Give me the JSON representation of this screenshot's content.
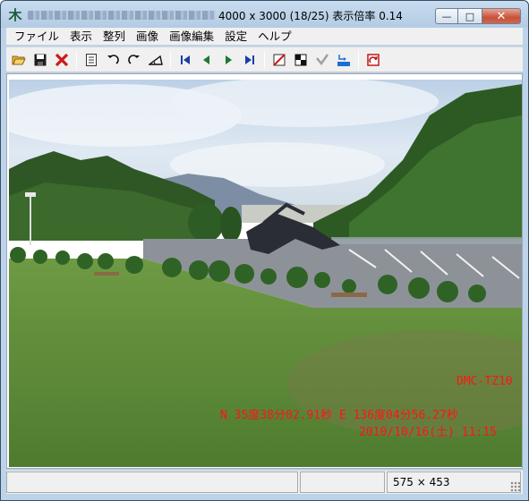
{
  "window": {
    "title_info": "4000 x 3000 (18/25)  表示倍率 0.14",
    "buttons": {
      "minimize": "—",
      "maximize": "□",
      "close": "✕"
    }
  },
  "menu": {
    "items": [
      "ファイル",
      "表示",
      "整列",
      "画像",
      "画像編集",
      "設定",
      "ヘルプ"
    ]
  },
  "toolbar": {
    "icons": [
      "folder-open-icon",
      "save-icon",
      "delete-icon",
      "properties-icon",
      "rotate-left-icon",
      "rotate-right-icon",
      "level-icon",
      "first-image-icon",
      "previous-image-icon",
      "next-image-icon",
      "last-image-icon",
      "no-fit-icon",
      "compare-icon",
      "exif-icon",
      "external-out-icon",
      "refresh-icon"
    ]
  },
  "image": {
    "exif_camera": "DMC-TZ10",
    "exif_gps": "N 35度38分02.91秒  E 136度04分56.27秒",
    "exif_datetime": "2010/10/16(土) 11:15",
    "colors": {
      "exif_text": "#ff1414",
      "sky": "#dfe9f3",
      "grass": "#5c8a3a"
    }
  },
  "status": {
    "cell1": "",
    "cell2": "",
    "dimensions": "575 × 453"
  }
}
